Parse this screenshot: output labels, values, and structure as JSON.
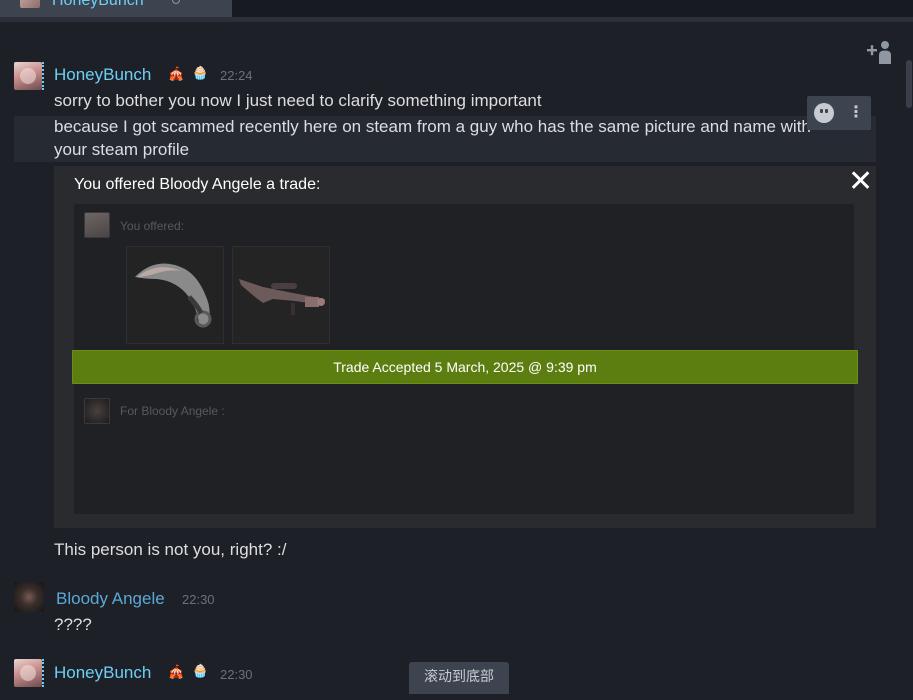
{
  "tab": {
    "name": "HoneyBunch"
  },
  "messages": [
    {
      "author": "HoneyBunch",
      "time": "22:24",
      "lines": [
        "sorry to bother you now I just need to clarify something important",
        "because I got scammed recently here on steam from a guy who has the same picture and name with",
        "your steam profile"
      ]
    },
    {
      "lines": [
        "This person is not you, right? :/"
      ]
    },
    {
      "author": "Bloody Angele",
      "time": "22:30",
      "lines": [
        "????"
      ]
    },
    {
      "author": "HoneyBunch",
      "time": "22:30"
    }
  ],
  "trade": {
    "title": "You offered Bloody Angele a trade:",
    "you_offered_label": "You offered:",
    "items": [
      {
        "icon": "karambit-knife-icon"
      },
      {
        "icon": "sniper-rifle-icon"
      }
    ],
    "status": "Trade Accepted 5 March, 2025 @ 9:39 pm",
    "for_label": "For Bloody Angele :"
  },
  "scroll_to_bottom": "滚动到底部",
  "colors": {
    "accent_blue": "#6dcff6",
    "trade_green": "#5c7e10",
    "background": "#1e2027"
  }
}
